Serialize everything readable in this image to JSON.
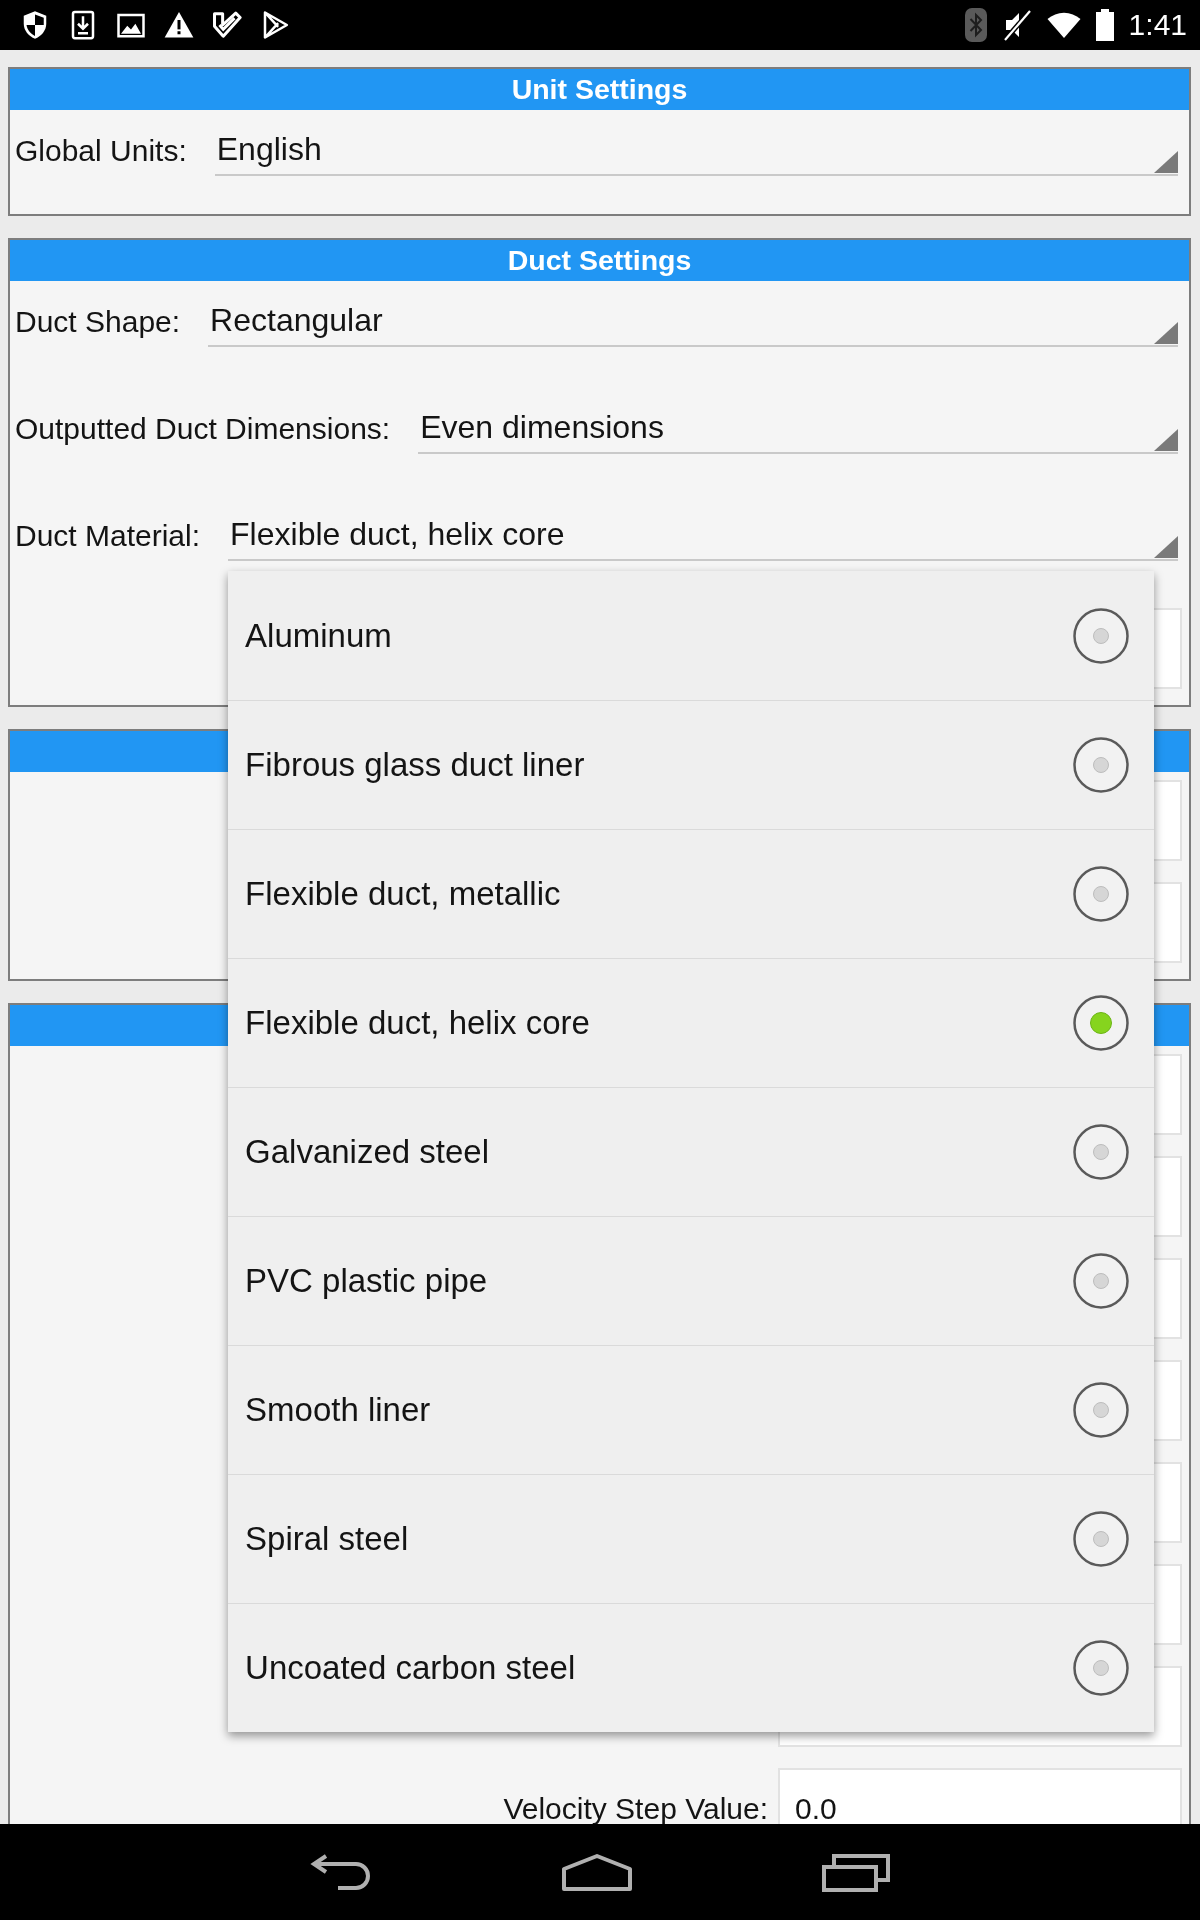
{
  "status_bar": {
    "time": "1:41"
  },
  "sections": [
    {
      "title": "Unit Settings",
      "rows": [
        {
          "kind": "dropdown",
          "label": "Global Units:",
          "value": "English"
        }
      ]
    },
    {
      "title": "Duct Settings",
      "rows": [
        {
          "kind": "dropdown",
          "label": "Duct Shape:",
          "value": "Rectangular"
        },
        {
          "kind": "dropdown",
          "label": "Outputted Duct Dimensions:",
          "value": "Even dimensions"
        },
        {
          "kind": "dropdown",
          "label": "Duct Material:",
          "value": "Flexible duct, helix core",
          "options": [
            {
              "label": "Aluminum",
              "selected": false
            },
            {
              "label": "Fibrous glass duct liner",
              "selected": false
            },
            {
              "label": "Flexible duct, metallic",
              "selected": false
            },
            {
              "label": "Flexible duct, helix core",
              "selected": true
            },
            {
              "label": "Galvanized steel",
              "selected": false
            },
            {
              "label": "PVC plastic pipe",
              "selected": false
            },
            {
              "label": "Smooth liner",
              "selected": false
            },
            {
              "label": "Spiral steel",
              "selected": false
            },
            {
              "label": "Uncoated carbon steel",
              "selected": false
            }
          ]
        },
        {
          "kind": "field"
        }
      ]
    },
    {
      "rows": [
        {
          "kind": "field"
        },
        {
          "kind": "field"
        }
      ]
    },
    {
      "rows": [
        {
          "kind": "field"
        },
        {
          "kind": "field"
        },
        {
          "kind": "field"
        },
        {
          "kind": "field"
        },
        {
          "kind": "field"
        },
        {
          "kind": "field"
        },
        {
          "kind": "field"
        },
        {
          "kind": "field",
          "label": "Velocity Step Value:",
          "value": "0.0"
        }
      ]
    }
  ]
}
